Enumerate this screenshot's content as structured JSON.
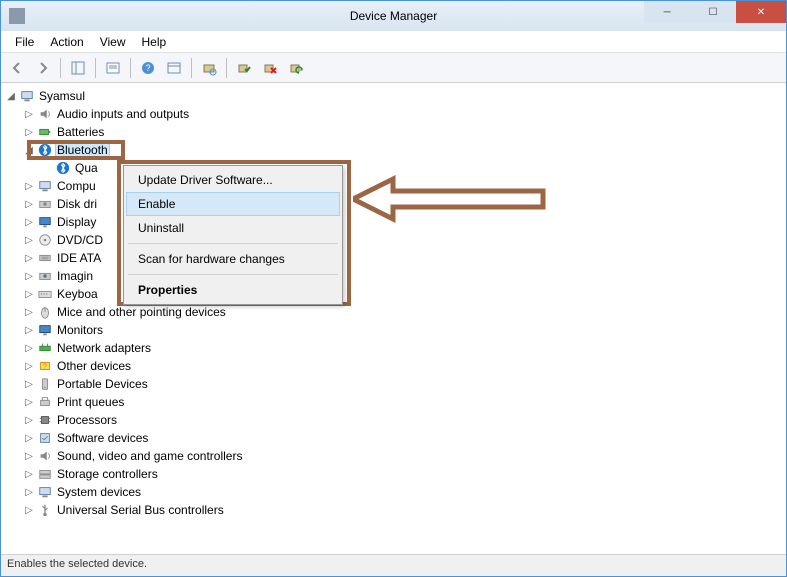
{
  "window": {
    "title": "Device Manager"
  },
  "menubar": {
    "file": "File",
    "action": "Action",
    "view": "View",
    "help": "Help"
  },
  "tree": {
    "root": "Syamsul",
    "items": [
      {
        "label": "Audio inputs and outputs",
        "icon": "audio"
      },
      {
        "label": "Batteries",
        "icon": "battery"
      },
      {
        "label": "Bluetooth",
        "icon": "bluetooth",
        "expanded": true,
        "selected": true
      },
      {
        "label": "Qua",
        "icon": "bluetooth",
        "child": true
      },
      {
        "label": "Compu",
        "icon": "computer"
      },
      {
        "label": "Disk dri",
        "icon": "disk"
      },
      {
        "label": "Display",
        "icon": "display"
      },
      {
        "label": "DVD/CD",
        "icon": "dvd"
      },
      {
        "label": "IDE ATA",
        "icon": "ide"
      },
      {
        "label": "Imagin",
        "icon": "imaging"
      },
      {
        "label": "Keyboa",
        "icon": "keyboard"
      },
      {
        "label": "Mice and other pointing devices",
        "icon": "mouse"
      },
      {
        "label": "Monitors",
        "icon": "monitor"
      },
      {
        "label": "Network adapters",
        "icon": "network"
      },
      {
        "label": "Other devices",
        "icon": "other"
      },
      {
        "label": "Portable Devices",
        "icon": "portable"
      },
      {
        "label": "Print queues",
        "icon": "printer"
      },
      {
        "label": "Processors",
        "icon": "cpu"
      },
      {
        "label": "Software devices",
        "icon": "software"
      },
      {
        "label": "Sound, video and game controllers",
        "icon": "sound"
      },
      {
        "label": "Storage controllers",
        "icon": "storage"
      },
      {
        "label": "System devices",
        "icon": "system"
      },
      {
        "label": "Universal Serial Bus controllers",
        "icon": "usb"
      }
    ]
  },
  "context_menu": {
    "update": "Update Driver Software...",
    "enable": "Enable",
    "uninstall": "Uninstall",
    "scan": "Scan for hardware changes",
    "properties": "Properties"
  },
  "statusbar": {
    "text": "Enables the selected device."
  },
  "annotation": {
    "highlight_color": "#9c6644"
  }
}
